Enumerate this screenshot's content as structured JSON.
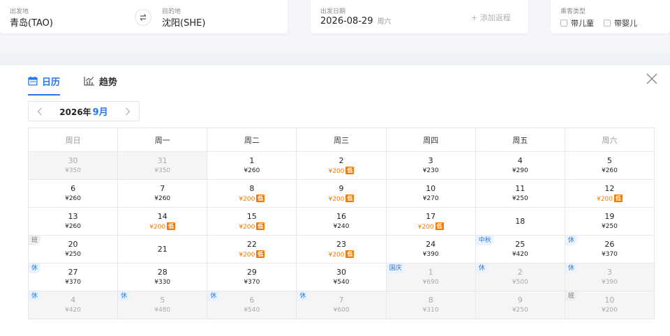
{
  "search": {
    "from_label": "出发地",
    "from_value": "青岛(TAO)",
    "to_label": "目的地",
    "to_value": "沈阳(SHE)",
    "date_label": "出发日期",
    "date_value": "2026-08-29",
    "date_weekday": "周六",
    "add_return": "+ 添加返程",
    "pax_label": "乘客类型",
    "pax_child": "带儿童",
    "pax_infant": "带婴儿"
  },
  "calendar": {
    "tabs": [
      {
        "label": "日历",
        "icon": "calendar-icon",
        "active": true
      },
      {
        "label": "趋势",
        "icon": "trend-chart-icon",
        "active": false
      }
    ],
    "year_label": "2026年",
    "month_label": "9月",
    "weekdays": [
      "周日",
      "周一",
      "周二",
      "周三",
      "周四",
      "周五",
      "周六"
    ],
    "low_badge": "低",
    "weeks": [
      [
        {
          "day": "30",
          "price": "¥350",
          "other": true
        },
        {
          "day": "31",
          "price": "¥350",
          "other": true
        },
        {
          "day": "1",
          "price": "¥260"
        },
        {
          "day": "2",
          "price": "¥200",
          "low": true
        },
        {
          "day": "3",
          "price": "¥230"
        },
        {
          "day": "4",
          "price": "¥290"
        },
        {
          "day": "5",
          "price": "¥260"
        }
      ],
      [
        {
          "day": "6",
          "price": "¥260"
        },
        {
          "day": "7",
          "price": "¥260"
        },
        {
          "day": "8",
          "price": "¥200",
          "low": true
        },
        {
          "day": "9",
          "price": "¥200",
          "low": true
        },
        {
          "day": "10",
          "price": "¥270"
        },
        {
          "day": "11",
          "price": "¥250"
        },
        {
          "day": "12",
          "price": "¥200",
          "low": true
        }
      ],
      [
        {
          "day": "13",
          "price": "¥260"
        },
        {
          "day": "14",
          "price": "¥200",
          "low": true
        },
        {
          "day": "15",
          "price": "¥200",
          "low": true
        },
        {
          "day": "16",
          "price": "¥240"
        },
        {
          "day": "17",
          "price": "¥200",
          "low": true
        },
        {
          "day": "18",
          "price": ""
        },
        {
          "day": "19",
          "price": "¥250"
        }
      ],
      [
        {
          "day": "20",
          "price": "¥250",
          "tag": "班",
          "tag_type": "work"
        },
        {
          "day": "21",
          "price": ""
        },
        {
          "day": "22",
          "price": "¥200",
          "low": true
        },
        {
          "day": "23",
          "price": "¥200",
          "low": true
        },
        {
          "day": "24",
          "price": "¥390"
        },
        {
          "day": "25",
          "price": "¥420",
          "tag": "中秋",
          "tag_type": "fest"
        },
        {
          "day": "26",
          "price": "¥370",
          "tag": "休",
          "tag_type": "rest"
        }
      ],
      [
        {
          "day": "27",
          "price": "¥370",
          "tag": "休",
          "tag_type": "rest"
        },
        {
          "day": "28",
          "price": "¥330"
        },
        {
          "day": "29",
          "price": "¥370"
        },
        {
          "day": "30",
          "price": "¥540"
        },
        {
          "day": "1",
          "price": "¥690",
          "other": true,
          "tag": "国庆",
          "tag_type": "fest"
        },
        {
          "day": "2",
          "price": "¥500",
          "other": true,
          "tag": "休",
          "tag_type": "rest"
        },
        {
          "day": "3",
          "price": "¥390",
          "other": true,
          "tag": "休",
          "tag_type": "rest"
        }
      ],
      [
        {
          "day": "4",
          "price": "¥420",
          "other": true,
          "tag": "休",
          "tag_type": "rest"
        },
        {
          "day": "5",
          "price": "¥480",
          "other": true,
          "tag": "休",
          "tag_type": "rest"
        },
        {
          "day": "6",
          "price": "¥540",
          "other": true,
          "tag": "休",
          "tag_type": "rest"
        },
        {
          "day": "7",
          "price": "¥600",
          "other": true,
          "tag": "休",
          "tag_type": "rest"
        },
        {
          "day": "8",
          "price": "¥310",
          "other": true
        },
        {
          "day": "9",
          "price": "¥250",
          "other": true
        },
        {
          "day": "10",
          "price": "¥200",
          "other": true,
          "tag": "班",
          "tag_type": "work"
        }
      ]
    ]
  },
  "colors": {
    "accent": "#2577e3",
    "low_price": "#f57a00",
    "other_month_bg": "#f5f5f5"
  }
}
